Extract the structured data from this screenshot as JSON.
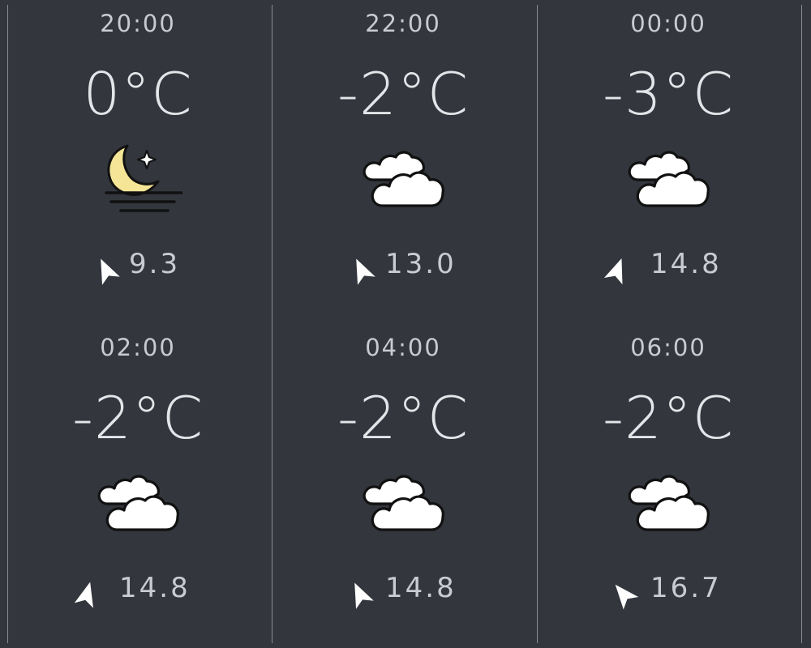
{
  "forecast": [
    {
      "time": "20:00",
      "temp": "0°C",
      "icon": "moon-icon",
      "wind_dir_deg": -25,
      "wind_speed": "9.3"
    },
    {
      "time": "22:00",
      "temp": "-2°C",
      "icon": "cloud-icon",
      "wind_dir_deg": -25,
      "wind_speed": "13.0"
    },
    {
      "time": "00:00",
      "temp": "-3°C",
      "icon": "cloud-icon",
      "wind_dir_deg": 20,
      "wind_speed": "14.8"
    },
    {
      "time": "02:00",
      "temp": "-2°C",
      "icon": "cloud-icon",
      "wind_dir_deg": 15,
      "wind_speed": "14.8"
    },
    {
      "time": "04:00",
      "temp": "-2°C",
      "icon": "cloud-icon",
      "wind_dir_deg": -25,
      "wind_speed": "14.8"
    },
    {
      "time": "06:00",
      "temp": "-2°C",
      "icon": "cloud-icon",
      "wind_dir_deg": -40,
      "wind_speed": "16.7"
    }
  ],
  "colors": {
    "background": "#33363d",
    "text": "#e4e5e8",
    "moon": "#f5e596",
    "cloud": "#ffffff"
  }
}
